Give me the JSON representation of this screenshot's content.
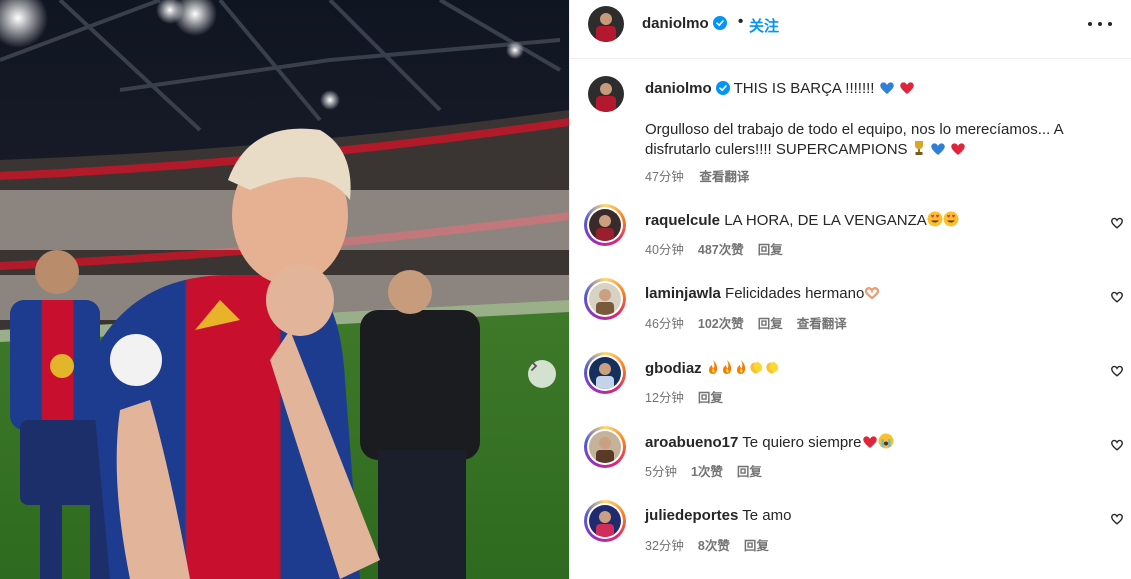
{
  "header": {
    "username": "daniolmo",
    "separator": "•",
    "follow_label": "关注"
  },
  "caption": {
    "username": "daniolmo",
    "title": "THIS IS BARÇA !!!!!!!",
    "body": "Orgulloso del trabajo de todo el equipo, nos lo merecíamos... A disfrutarlo culers!!!! SUPERCAMPIONS",
    "time": "47分钟",
    "translate_label": "查看翻译"
  },
  "comments": [
    {
      "username": "raquelcule",
      "text": "LA HORA, DE LA VENGANZA",
      "emoji": [
        "heart-eyes",
        "heart-eyes"
      ],
      "time": "40分钟",
      "likes": "487次赞",
      "reply": "回复",
      "translate": ""
    },
    {
      "username": "laminjawla",
      "text": "Felicidades hermano",
      "emoji": [
        "heart-hands"
      ],
      "time": "46分钟",
      "likes": "102次赞",
      "reply": "回复",
      "translate": "查看翻译"
    },
    {
      "username": "gbodiaz",
      "text": "",
      "emoji": [
        "fire",
        "fire",
        "fire",
        "clap",
        "clap"
      ],
      "time": "12分钟",
      "likes": "",
      "reply": "回复",
      "translate": ""
    },
    {
      "username": "aroabueno17",
      "text": "Te quiero siempre",
      "emoji": [
        "red-heart",
        "crying-face"
      ],
      "time": "5分钟",
      "likes": "1次赞",
      "reply": "回复",
      "translate": ""
    },
    {
      "username": "juliedeportes",
      "text": "Te amo",
      "emoji": [],
      "time": "32分钟",
      "likes": "8次赞",
      "reply": "回复",
      "translate": ""
    }
  ],
  "colors": {
    "accent": "#0095f6",
    "text": "#262626",
    "muted": "#737373",
    "barca_blue": "#1d3c8f",
    "barca_red": "#c8102e"
  },
  "icons": [
    "verified-badge-icon",
    "more-options-icon",
    "next-slide-icon",
    "heart-outline-icon"
  ]
}
